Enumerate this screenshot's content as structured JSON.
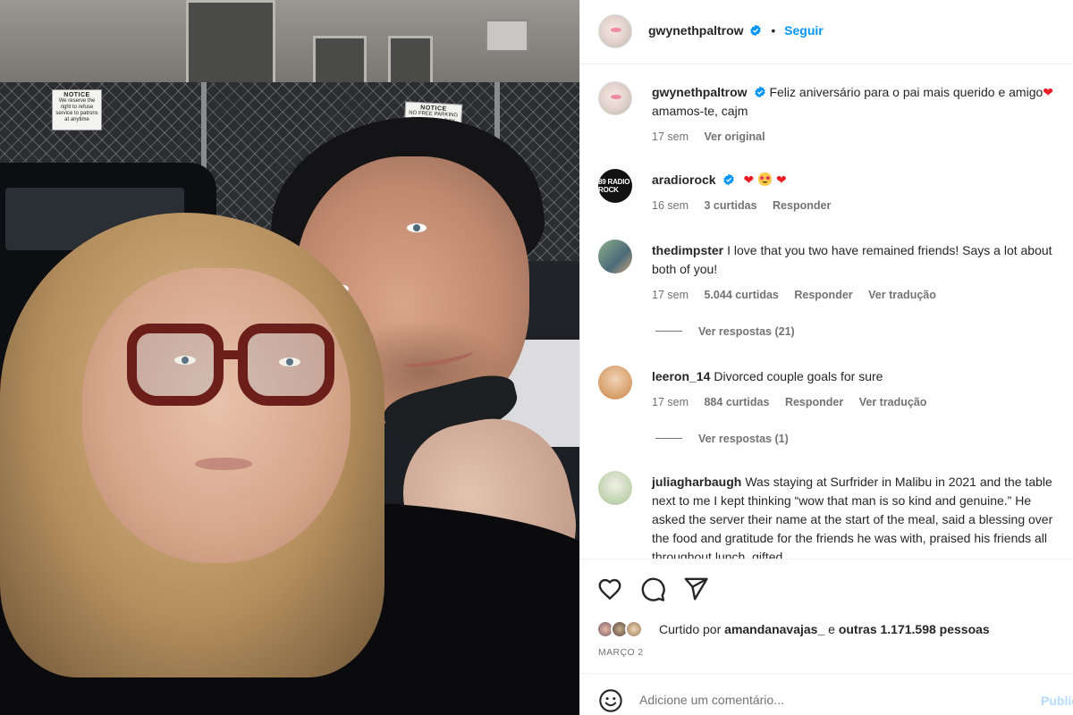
{
  "post": {
    "author": "gwynethpaltrow",
    "follow_label": "Seguir",
    "separator": "•"
  },
  "caption": {
    "username": "gwynethpaltrow",
    "text_1": "Feliz aniversário para o pai mais querido e amigo",
    "text_2": " amamos-te, cajm",
    "time": "17 sem",
    "see_original": "Ver original"
  },
  "photo": {
    "sign_1_title": "NOTICE",
    "sign_1_text": "We reserve the right to refuse service to patrons at anytime",
    "sign_2_title": "NOTICE",
    "sign_2_text": "NO FREE PARKING 24 HOURS A DAY"
  },
  "comments": [
    {
      "username": "aradiorock",
      "avatar_text": "89 RADIO ROCK",
      "text": "",
      "time": "16 sem",
      "likes": "3 curtidas",
      "reply": "Responder"
    },
    {
      "username": "thedimpster",
      "text": "I love that you two have remained friends! Says a lot about both of you!",
      "time": "17 sem",
      "likes": "5.044 curtidas",
      "reply": "Responder",
      "translate": "Ver tradução",
      "view_replies": "Ver respostas (21)"
    },
    {
      "username": "leeron_14",
      "text": "Divorced couple goals for sure",
      "time": "17 sem",
      "likes": "884 curtidas",
      "reply": "Responder",
      "translate": "Ver tradução",
      "view_replies": "Ver respostas (1)"
    },
    {
      "username": "juliagharbaugh",
      "text": "Was staying at Surfrider in Malibu in 2021 and the table next to me I kept thinking “wow that man is so kind and genuine.” He asked the server their name at the start of the meal, said a blessing over the food and gratitude for the friends he was with, praised his friends all throughout lunch, gifted..."
    }
  ],
  "likes": {
    "prefix": "Curtido por ",
    "user": "amandanavajas_",
    "middle": " e ",
    "others": "outras 1.171.598 pessoas"
  },
  "date": "MARÇO 2",
  "add_comment": {
    "placeholder": "Adicione um comentário...",
    "publish_label": "Publicar"
  },
  "colors": {
    "accent": "#0095f6",
    "verified": "#0095f6",
    "heart": "#ed1c24",
    "muted_text": "#737373"
  },
  "icons": [
    "verified-badge-icon",
    "heart-icon",
    "comment-icon",
    "share-icon",
    "emoji-icon",
    "heart-emoji",
    "star-struck-emoji"
  ]
}
